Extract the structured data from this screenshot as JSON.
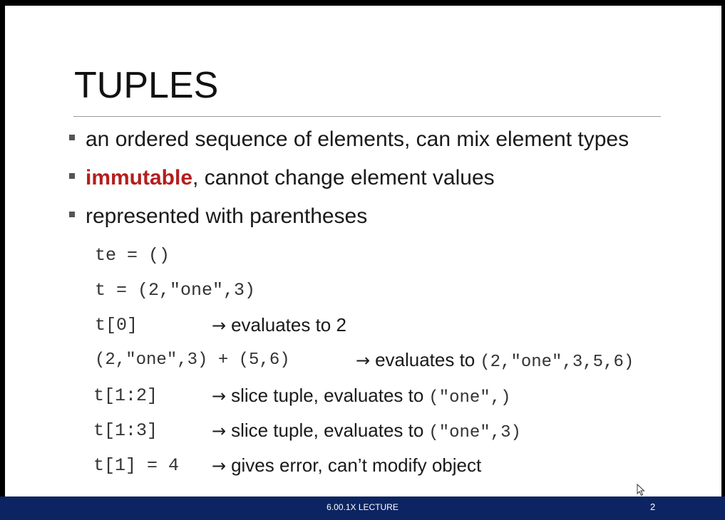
{
  "slide": {
    "title": "TUPLES",
    "bullets": [
      {
        "highlight": "",
        "text": "an ordered sequence of elements, can mix element types"
      },
      {
        "highlight": "immutable",
        "text": ", cannot change element values"
      },
      {
        "highlight": "",
        "text": "represented with parentheses"
      }
    ],
    "code_lines": [
      {
        "code": "te = ()",
        "arrow": "",
        "desc": "",
        "result": ""
      },
      {
        "code": "t = (2,\"one\",3)",
        "arrow": "",
        "desc": "",
        "result": ""
      },
      {
        "code": "t[0]",
        "arrow": "→",
        "desc": "evaluates to 2",
        "result": ""
      },
      {
        "code": "(2,\"one\",3) + (5,6)",
        "arrow": "→",
        "desc": "evaluates to",
        "result": "(2,\"one\",3,5,6)"
      },
      {
        "code": "t[1:2]",
        "arrow": "→",
        "desc": "slice tuple, evaluates to",
        "result": "(\"one\",)"
      },
      {
        "code": "t[1:3]",
        "arrow": "→",
        "desc": "slice tuple, evaluates to",
        "result": "(\"one\",3)"
      },
      {
        "code": "t[1] = 4",
        "arrow": "→",
        "desc": "gives error, can’t modify object",
        "result": ""
      }
    ]
  },
  "footer": {
    "center_text": "6.00.1X LECTURE",
    "page_number": "2"
  },
  "colors": {
    "highlight": "#b41e1e",
    "footer_background": "#0c2461"
  },
  "icons": {
    "bullet": "square-bullet-icon",
    "arrow": "right-arrow-icon",
    "cursor": "mouse-cursor-icon"
  }
}
